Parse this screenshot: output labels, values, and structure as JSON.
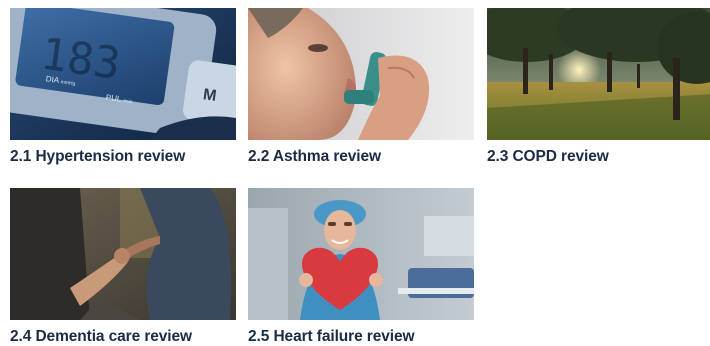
{
  "cards": [
    {
      "title": "2.1 Hypertension review",
      "image": "blood-pressure-monitor"
    },
    {
      "title": "2.2 Asthma review",
      "image": "man-using-inhaler"
    },
    {
      "title": "2.3 COPD review",
      "image": "park-trees-sunset"
    },
    {
      "title": "2.4 Dementia care review",
      "image": "holding-hands"
    },
    {
      "title": "2.5 Heart failure review",
      "image": "nurse-holding-heart"
    }
  ],
  "monitor_labels": {
    "dia": "DIA",
    "dia_unit": "mmHg",
    "pul": "PUL",
    "pul_unit": "/min"
  }
}
